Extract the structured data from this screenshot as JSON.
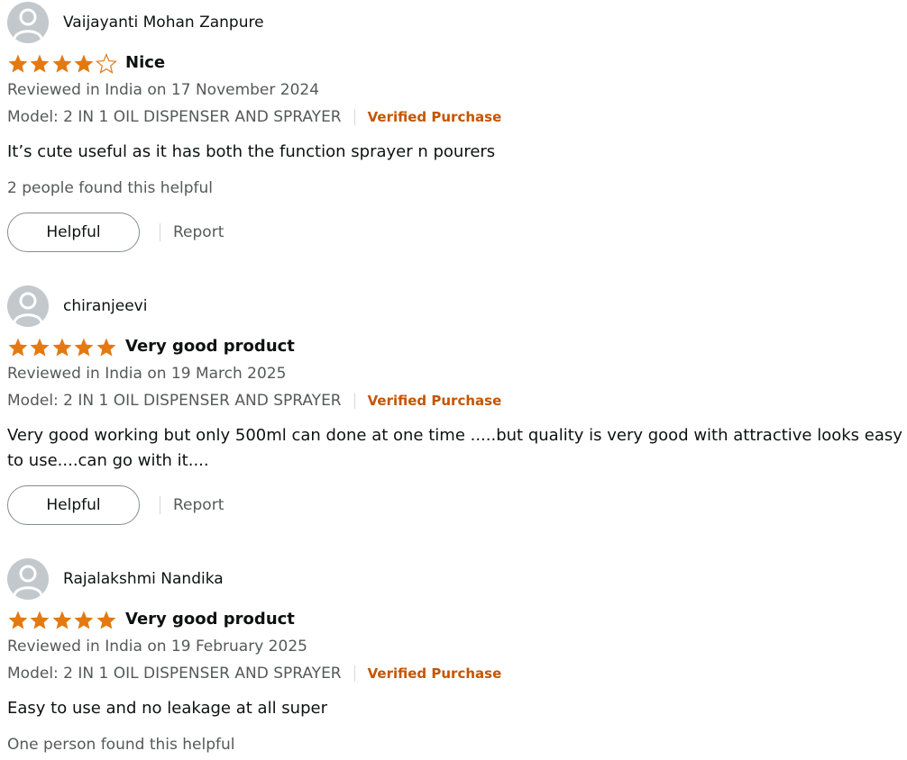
{
  "reviews": [
    {
      "reviewer": "Vaijayanti Mohan Zanpure",
      "rating": 4,
      "title": "Nice",
      "date": "Reviewed in India on 17 November 2024",
      "model": "Model: 2 IN 1 OIL DISPENSER AND SPRAYER",
      "verified": "Verified Purchase",
      "body": "It’s cute useful as it has both the function sprayer n pourers",
      "helpful_count": "2 people found this helpful",
      "helpful_label": "Helpful",
      "report_label": "Report"
    },
    {
      "reviewer": "chiranjeevi",
      "rating": 5,
      "title": "Very good product",
      "date": "Reviewed in India on 19 March 2025",
      "model": "Model: 2 IN 1 OIL DISPENSER AND SPRAYER",
      "verified": "Verified Purchase",
      "body": "Very good working but only 500ml can done at one time .....but quality is very good with attractive looks easy to use....can go with it....",
      "helpful_label": "Helpful",
      "report_label": "Report"
    },
    {
      "reviewer": "Rajalakshmi Nandika",
      "rating": 5,
      "title": "Very good product",
      "date": "Reviewed in India on 19 February 2025",
      "model": "Model: 2 IN 1 OIL DISPENSER AND SPRAYER",
      "verified": "Verified Purchase",
      "body": "Easy to use and no leakage at all super",
      "helpful_count": "One person found this helpful"
    }
  ],
  "colors": {
    "star_filled": "#e47911",
    "star_outline": "#e47911",
    "verified": "#c45500",
    "avatar_bg": "#c3c8cc",
    "avatar_icon": "#ffffff"
  },
  "icons": {
    "avatar": "user-silhouette-icon",
    "star": "star-icon"
  }
}
